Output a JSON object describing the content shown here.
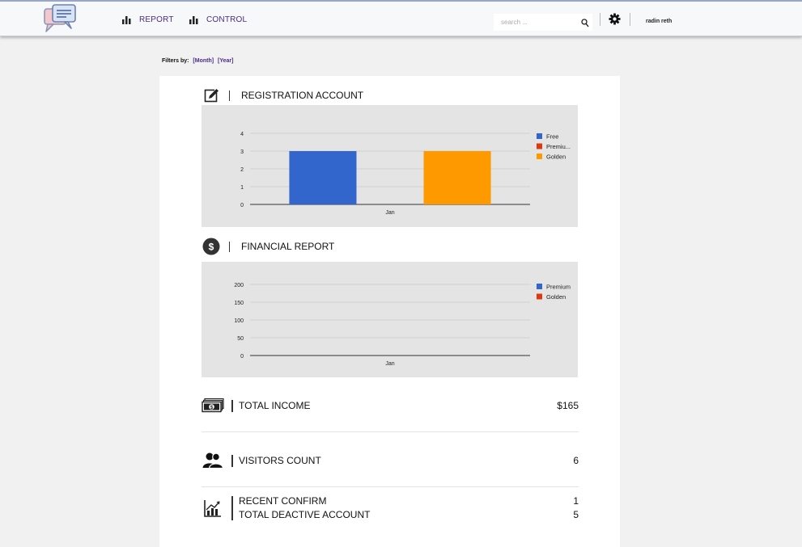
{
  "header": {
    "nav": [
      {
        "label": "REPORT",
        "icon": "bar-chart-icon"
      },
      {
        "label": "CONTROL",
        "icon": "bar-chart-icon"
      }
    ],
    "search_placeholder": "search ...",
    "username": "radin reth"
  },
  "filters": {
    "label": "Filters by:",
    "month": "[Month]",
    "year": "[Year]"
  },
  "registration": {
    "title": "REGISTRATION ACCOUNT",
    "icon": "edit-icon"
  },
  "financial": {
    "title": "FINANCIAL REPORT",
    "icon": "dollar-icon"
  },
  "chart_data": [
    {
      "type": "bar",
      "categories": [
        "Jan"
      ],
      "series": [
        {
          "name": "Free",
          "values": [
            3
          ],
          "color": "#3366cc"
        },
        {
          "name": "Premiu...",
          "values": [
            0
          ],
          "color": "#dc3912"
        },
        {
          "name": "Golden",
          "values": [
            3
          ],
          "color": "#ff9900"
        }
      ],
      "y_ticks": [
        "0",
        "1",
        "2",
        "3",
        "4"
      ],
      "ylim": [
        0,
        4
      ],
      "grid": true,
      "legend": "right"
    },
    {
      "type": "line",
      "categories": [
        "Jan"
      ],
      "series": [
        {
          "name": "Premium",
          "values": [
            0
          ],
          "color": "#3366cc"
        },
        {
          "name": "Golden",
          "values": [
            0
          ],
          "color": "#dc3912"
        }
      ],
      "y_ticks": [
        "0",
        "50",
        "100",
        "150",
        "200"
      ],
      "ylim": [
        0,
        200
      ],
      "grid": true,
      "legend": "right"
    }
  ],
  "stats": {
    "total_income": {
      "label": "TOTAL INCOME",
      "value": "$165",
      "icon": "money-icon"
    },
    "visitors": {
      "label": "VISITORS COUNT",
      "value": "6",
      "icon": "users-icon"
    },
    "recent_confirm": {
      "label": "RECENT CONFIRM",
      "value": "1"
    },
    "deactive": {
      "label": "TOTAL DEACTIVE ACCOUNT",
      "value": "5"
    },
    "trend_icon": "trending-chart-icon"
  },
  "colors": {
    "nav_text": "#4b2b8a",
    "chart_bg": "#e4e4e5",
    "free": "#3366cc",
    "premium": "#dc3912",
    "golden": "#ff9900"
  }
}
